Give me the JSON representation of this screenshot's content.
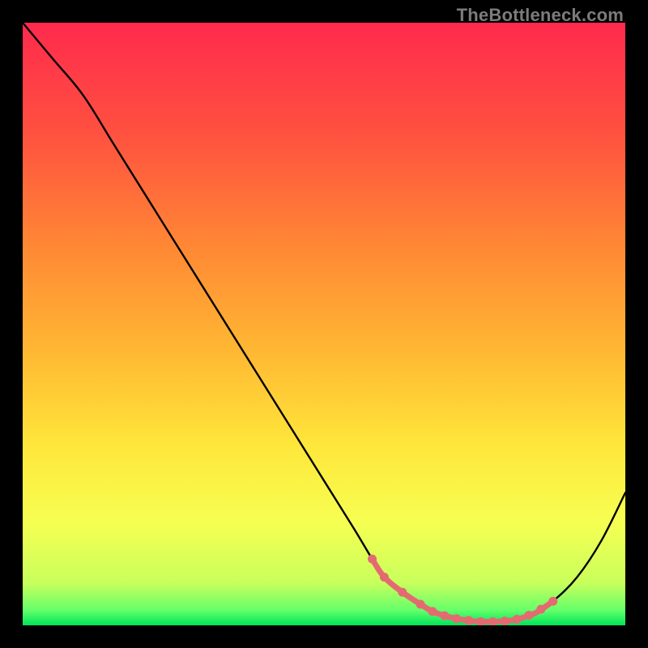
{
  "watermark": "TheBottleneck.com",
  "colors": {
    "curve": "#000000",
    "highlight": "#e46a72",
    "dot": "#e46a72"
  },
  "chart_data": {
    "type": "line",
    "title": "",
    "xlabel": "",
    "ylabel": "",
    "xlim": [
      0,
      100
    ],
    "ylim": [
      0,
      100
    ],
    "grid": false,
    "legend": false,
    "x": [
      0,
      5,
      10,
      15,
      20,
      25,
      30,
      35,
      40,
      45,
      50,
      55,
      58,
      60,
      63,
      66,
      68,
      70,
      72,
      74,
      76,
      78,
      80,
      82,
      85,
      88,
      92,
      96,
      100
    ],
    "values": [
      100,
      94,
      88,
      80,
      72,
      64,
      56,
      48,
      40,
      32,
      24,
      16,
      11,
      8,
      5.5,
      3.5,
      2.3,
      1.6,
      1.1,
      0.8,
      0.6,
      0.6,
      0.7,
      1.0,
      2.0,
      4.0,
      8.0,
      14,
      22
    ],
    "highlight_range_x": [
      58,
      88
    ],
    "highlight_dots_x": [
      58,
      60,
      63,
      66,
      68,
      70,
      72,
      74,
      76,
      78,
      80,
      82,
      84,
      86,
      88
    ]
  }
}
